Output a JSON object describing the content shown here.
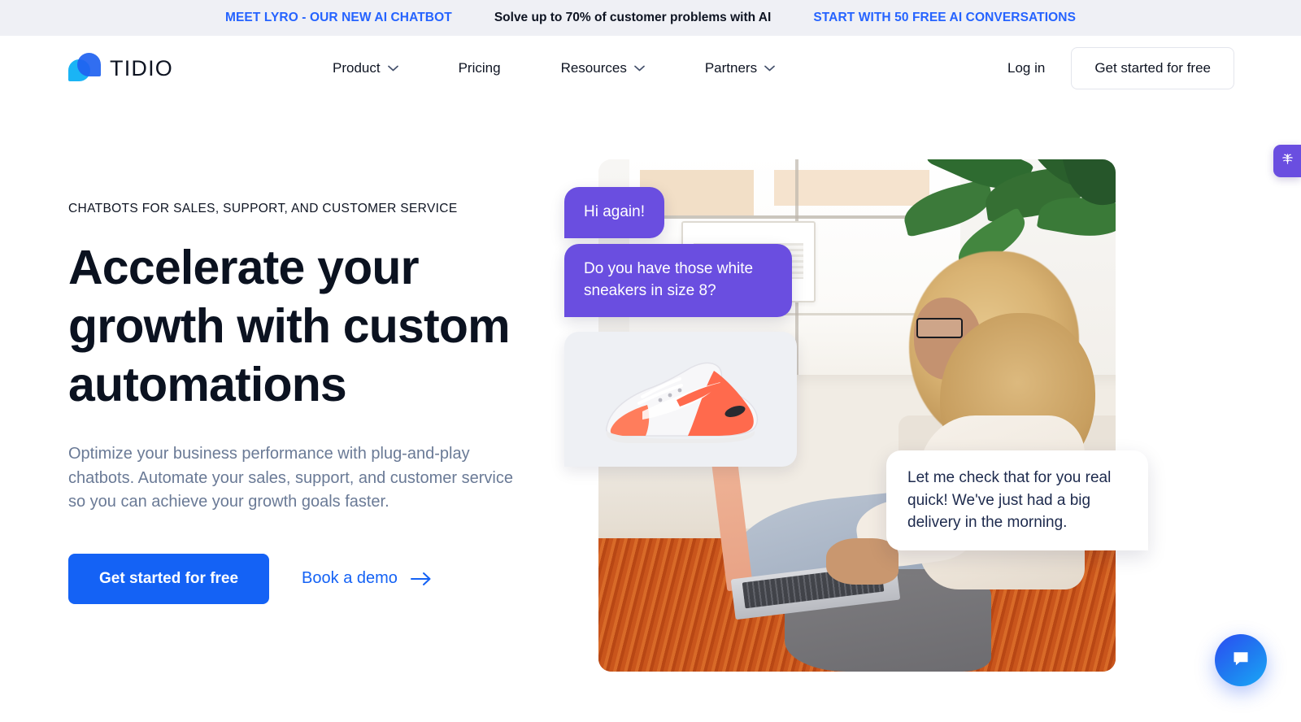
{
  "announcement": {
    "left_link": "MEET LYRO - OUR NEW AI CHATBOT",
    "middle_text": "Solve up to 70% of customer problems with AI",
    "right_link": "START WITH 50 FREE AI CONVERSATIONS",
    "link_color": "#2563ff",
    "background": "#eff0f5"
  },
  "header": {
    "brand": "TIDIO",
    "nav": [
      {
        "label": "Product",
        "has_dropdown": true
      },
      {
        "label": "Pricing",
        "has_dropdown": false
      },
      {
        "label": "Resources",
        "has_dropdown": true
      },
      {
        "label": "Partners",
        "has_dropdown": true
      }
    ],
    "login_label": "Log in",
    "cta_label": "Get started for free"
  },
  "hero": {
    "eyebrow": "CHATBOTS FOR SALES, SUPPORT, AND CUSTOMER SERVICE",
    "headline": "Accelerate your growth with custom automations",
    "subcopy": "Optimize your business performance with plug-and-play chatbots. Automate your sales, support, and customer service so you can achieve your growth goals faster.",
    "primary_cta": "Get started for free",
    "secondary_cta": "Book a demo",
    "primary_color": "#1462f5"
  },
  "chat_preview": {
    "bubble_visitor_1": "Hi again!",
    "bubble_visitor_2": "Do you have those white sneakers in size 8?",
    "bubble_agent": "Let me check that for you real quick! We've just had a big delivery in the morning.",
    "product_card_alt": "white and coral running sneaker",
    "visitor_bubble_color": "#6a4ee0",
    "agent_bubble_color": "#ffffff"
  },
  "widgets": {
    "edge_tab_icon": "brain-icon",
    "launcher_icon": "chat-bubble-icon",
    "launcher_color": "#1f7ef0"
  }
}
